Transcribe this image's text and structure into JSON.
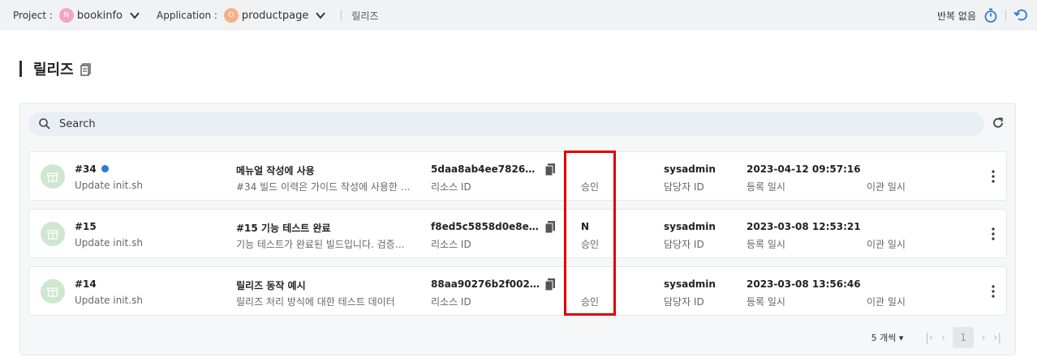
{
  "topbar": {
    "project_label": "Project :",
    "project_badge": "N",
    "project_value": "bookinfo",
    "project_color": "#f4a6c0",
    "application_label": "Application :",
    "application_badge": "O",
    "application_value": "productpage",
    "application_color": "#f6b08a",
    "breadcrumb": "릴리즈",
    "repeat_label": "반복 없음"
  },
  "page": {
    "title": "릴리즈"
  },
  "search": {
    "placeholder": "Search"
  },
  "rows": [
    {
      "id": "#34",
      "has_dot": true,
      "commit": "Update init.sh",
      "title": "메뉴얼 작성에 사용",
      "description": "#34 빌드 이력은 가이드 작성에 사용한 릴리…",
      "hash": "5daa8ab4ee78265a4ea…",
      "hash_label": "리소스 ID",
      "flag": "",
      "approval": "승인",
      "owner": "sysadmin",
      "owner_label": "담당자 ID",
      "registered": "2023-04-12 09:57:16",
      "registered_label": "등록 일시",
      "migrated": "",
      "migrated_label": "이관 일시"
    },
    {
      "id": "#15",
      "has_dot": false,
      "commit": "Update init.sh",
      "title": "#15 기능 테스트 완료",
      "description": "기능 테스트가 완료된 빌드입니다. 검증계에…",
      "hash": "f8ed5c5858d0e8eff6f5…",
      "hash_label": "리소스 ID",
      "flag": "N",
      "approval": "승인",
      "owner": "sysadmin",
      "owner_label": "담당자 ID",
      "registered": "2023-03-08 12:53:21",
      "registered_label": "등록 일시",
      "migrated": "",
      "migrated_label": "이관 일시"
    },
    {
      "id": "#14",
      "has_dot": false,
      "commit": "Update init.sh",
      "title": "릴리즈 동작 예시",
      "description": "릴리즈 처리 방식에 대한 테스트 데이터",
      "hash": "88aa90276b2f00290d3f…",
      "hash_label": "리소스 ID",
      "flag": "",
      "approval": "승인",
      "owner": "sysadmin",
      "owner_label": "담당자 ID",
      "registered": "2023-03-08 13:56:46",
      "registered_label": "등록 일시",
      "migrated": "",
      "migrated_label": "이관 일시"
    }
  ],
  "pagination": {
    "page_size": "5 개씩",
    "current_page": "1"
  },
  "colors": {
    "accent": "#2b7ad9",
    "highlight": "#e00000",
    "row_icon_bg": "#cfe6cf"
  }
}
